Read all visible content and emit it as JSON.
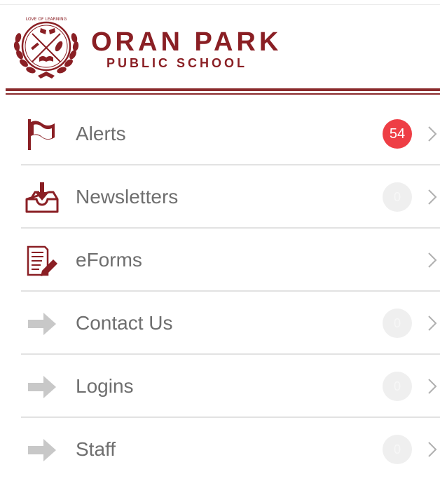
{
  "school": {
    "name": "ORAN PARK",
    "subtitle": "PUBLIC SCHOOL",
    "crest_motto": "LOVE OF LEARNING"
  },
  "colors": {
    "brand": "#8a1f24",
    "badge_alert": "#ee3e45",
    "badge_empty": "#efefef",
    "arrow_gray": "#c8c8c8"
  },
  "menu": {
    "items": [
      {
        "label": "Alerts",
        "badge": "54",
        "icon": "flag-icon"
      },
      {
        "label": "Newsletters",
        "badge": "0",
        "icon": "inbox-download-icon"
      },
      {
        "label": "eForms",
        "badge": "",
        "icon": "form-pen-icon"
      },
      {
        "label": "Contact Us",
        "badge": "0",
        "icon": "arrow-right-icon"
      },
      {
        "label": "Logins",
        "badge": "0",
        "icon": "arrow-right-icon"
      },
      {
        "label": "Staff",
        "badge": "0",
        "icon": "arrow-right-icon"
      }
    ]
  }
}
